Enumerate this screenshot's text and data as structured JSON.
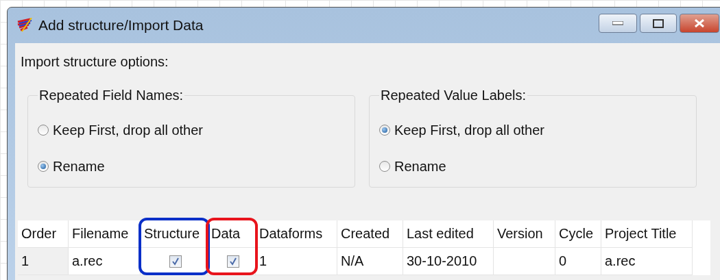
{
  "window": {
    "title": "Add structure/Import Data"
  },
  "options_label": "Import structure options:",
  "groups": [
    {
      "title": "Repeated Field Names:",
      "options": [
        {
          "label": "Keep First, drop all other",
          "selected": false
        },
        {
          "label": "Rename",
          "selected": true
        }
      ]
    },
    {
      "title": "Repeated Value Labels:",
      "options": [
        {
          "label": "Keep First, drop all other",
          "selected": true
        },
        {
          "label": "Rename",
          "selected": false
        }
      ]
    }
  ],
  "table": {
    "columns": [
      {
        "label": "Order"
      },
      {
        "label": "Filename"
      },
      {
        "label": "Structure",
        "color": "#0a2fc8"
      },
      {
        "label": "Data",
        "color": "#e8141c"
      },
      {
        "label": "Dataforms"
      },
      {
        "label": "Created"
      },
      {
        "label": "Last edited"
      },
      {
        "label": "Version"
      },
      {
        "label": "Cycle"
      },
      {
        "label": "Project Title"
      }
    ],
    "rows": [
      [
        {
          "kind": "text",
          "text": "1"
        },
        {
          "kind": "text",
          "text": "a.rec"
        },
        {
          "kind": "check",
          "checked": true
        },
        {
          "kind": "check",
          "checked": true
        },
        {
          "kind": "text",
          "text": "1"
        },
        {
          "kind": "text",
          "text": "N/A"
        },
        {
          "kind": "text",
          "text": "30-10-2010"
        },
        {
          "kind": "empty"
        },
        {
          "kind": "text",
          "text": "0"
        },
        {
          "kind": "text",
          "text": "a.rec"
        }
      ]
    ]
  }
}
